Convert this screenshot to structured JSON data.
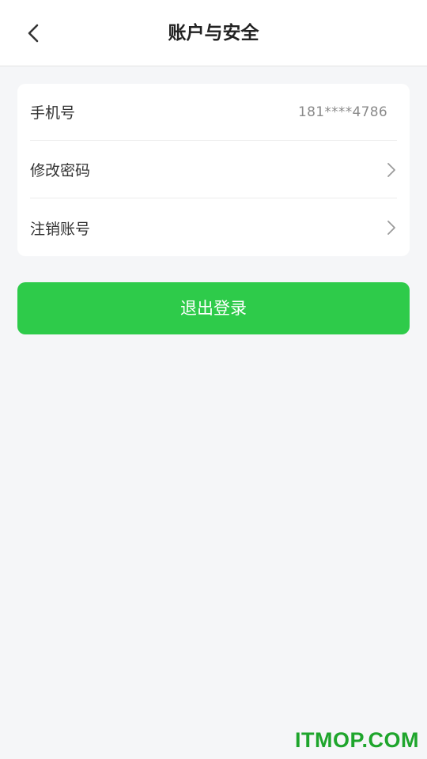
{
  "header": {
    "title": "账户与安全",
    "back_icon": "chevron-left-icon"
  },
  "account": {
    "rows": [
      {
        "label": "手机号",
        "value": "181****4786"
      },
      {
        "label": "修改密码",
        "icon": "chevron-right-icon"
      },
      {
        "label": "注销账号",
        "icon": "chevron-right-icon"
      }
    ]
  },
  "logout": {
    "label": "退出登录",
    "color": "#2ecb4a"
  },
  "watermark": {
    "text": "ITMOP.COM",
    "color": "#1ea52c"
  }
}
